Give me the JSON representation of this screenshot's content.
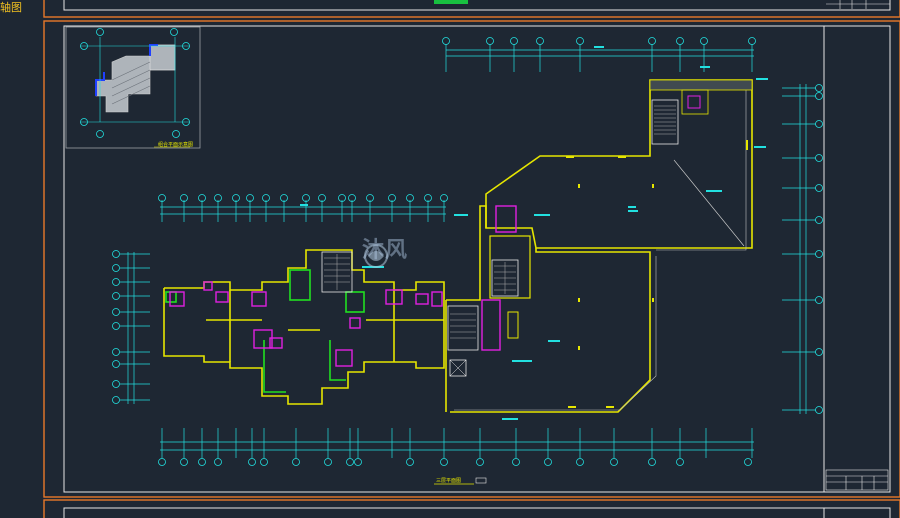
{
  "app": {
    "side_label": "轴图",
    "watermark_text": "沐风"
  },
  "colors": {
    "background": "#1e2733",
    "sheet_border": "#e8782a",
    "frame_white": "#e6e6e6",
    "wall_yellow": "#e6e600",
    "wall_magenta": "#e020e0",
    "axis_cyan": "#22e0e0",
    "green": "#20e020",
    "top_green_block": "#18c040"
  },
  "drawing": {
    "main_caption": "三层平面图",
    "keyplan_caption": "组合平面示意图",
    "axis_numbers_top_right": [
      "1",
      "2",
      "3",
      "4",
      "5",
      "6",
      "7",
      "8",
      "9"
    ],
    "axis_numbers_bottom": [
      "1",
      "2",
      "3",
      "4",
      "5",
      "6",
      "7",
      "8",
      "9",
      "10",
      "11",
      "12",
      "13",
      "14",
      "15",
      "16",
      "17",
      "18",
      "19",
      "20"
    ],
    "axis_letters_left": [
      "A",
      "B",
      "C",
      "D",
      "E",
      "F",
      "G",
      "H",
      "J",
      "K"
    ],
    "axis_letters_right": [
      "A",
      "B",
      "C",
      "D",
      "E",
      "F",
      "G",
      "H",
      "J",
      "K"
    ]
  }
}
